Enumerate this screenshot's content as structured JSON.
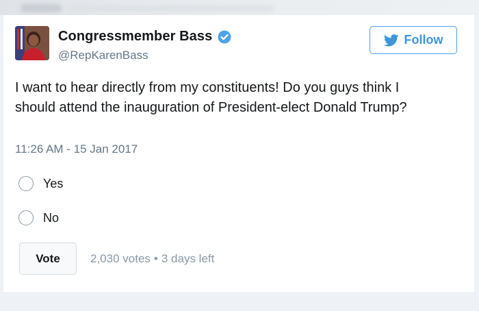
{
  "tweet": {
    "author_name": "Congressmember Bass",
    "handle": "@RepKarenBass",
    "follow_label": "Follow",
    "text": "I want to hear directly from my constituents! Do you guys think I should attend the inauguration of President-elect Donald Trump?",
    "timestamp": "11:26 AM - 15 Jan 2017"
  },
  "poll": {
    "options": [
      {
        "label": "Yes"
      },
      {
        "label": "No"
      }
    ],
    "vote_label": "Vote",
    "votes": "2,030 votes",
    "separator": "•",
    "time_left": "3 days left"
  },
  "colors": {
    "accent": "#1da1f2",
    "verified": "#1da1f2",
    "text": "#14171a",
    "muted": "#657786"
  },
  "icons": {
    "verified": "verified-badge-icon",
    "follow": "twitter-bird-icon"
  }
}
